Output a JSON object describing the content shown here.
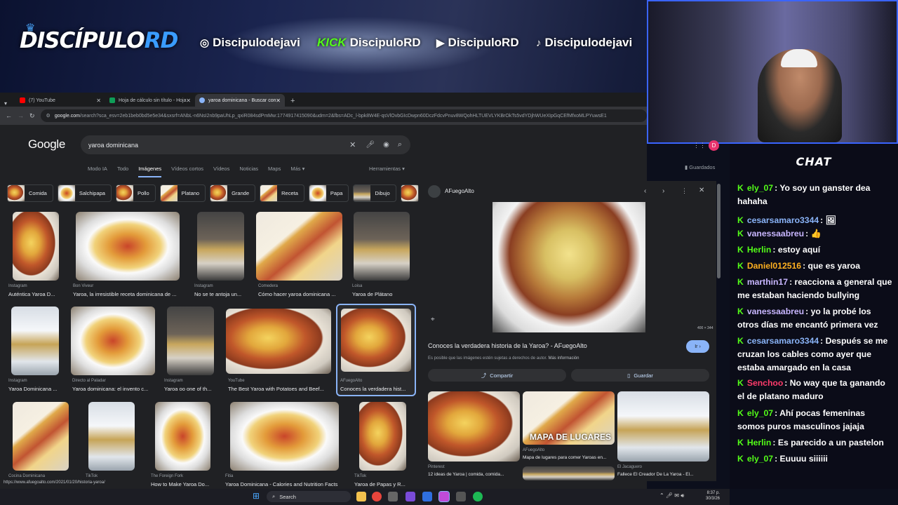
{
  "stream": {
    "logo": {
      "part1": "DISCÍPULO",
      "part2": "RD"
    },
    "socials": [
      {
        "icon": "instagram-icon",
        "handle": "Discipulodejavi"
      },
      {
        "icon": "kick-logo",
        "prefix": "KICK",
        "handle": "DiscipuloRD"
      },
      {
        "icon": "youtube-icon",
        "handle": "DiscipuloRD"
      },
      {
        "icon": "tiktok-icon",
        "handle": "Discipulodejavi"
      }
    ],
    "chat_title": "CHAT"
  },
  "browser": {
    "tabs": [
      {
        "label": "(7) YouTube",
        "color": "#ff0000"
      },
      {
        "label": "Hoja de cálculo sin título - Hoja",
        "color": "#0f9d58"
      },
      {
        "label": "yaroa dominicana - Buscar con",
        "color": "#8ab4f8"
      }
    ],
    "address": {
      "domain": "google.com",
      "path": "/search?sca_esv=2eb1beb0bd5e5e34&sxsrf=ANbL-n6NsI2nb9paUhLp_qxiR084sdPmMw:1774917415090&udm=2&fbs=ADc_l-bpk8W4E-qsVlOvbGIcDwpn60DczFdcvPnuv8WQohHLTUEVLYKBrOkTs5vdYDjhWUeXIpGqCEfMfxoMLPYuwsE1"
    },
    "status_url": "https://www.afuegoalto.com/2021/01/20/historia-yaroa/"
  },
  "google": {
    "logo": "Google",
    "query": "yaroa dominicana",
    "tabs": [
      "Modo IA",
      "Todo",
      "Imágenes",
      "Vídeos cortos",
      "Vídeos",
      "Noticias",
      "Maps",
      "Más"
    ],
    "tools": "Herramientas",
    "saved": "Guardados",
    "chips": [
      "Comida",
      "Salchipapa",
      "Pollo",
      "Platano",
      "Grande",
      "Receta",
      "Papa",
      "Dibujo"
    ],
    "results": [
      {
        "source": "Instagram",
        "title": "Auténtica Yaroa D..."
      },
      {
        "source": "Bon Viveur",
        "title": "Yaroa, la irresistible receta dominicana de ..."
      },
      {
        "source": "Instagram",
        "title": "No se te antoja un..."
      },
      {
        "source": "Comedera",
        "title": "Cómo hacer yaroa dominicana ..."
      },
      {
        "source": "Loisa",
        "title": "Yaroa de Plátano"
      },
      {
        "source": "Instagram",
        "title": "Yaroa Dominicana ..."
      },
      {
        "source": "Directo al Paladar",
        "title": "Yaroa dominicana: el invento c..."
      },
      {
        "source": "Instagram",
        "title": "Yaroa oo one of th..."
      },
      {
        "source": "YouTube",
        "title": "The Best Yaroa with Potatoes and Beef..."
      },
      {
        "source": "AFuegoAlto",
        "title": "Conoces la verdadera hist..."
      },
      {
        "source": "Cocina Dominicana",
        "title": "Yaroa Dominicana"
      },
      {
        "source": "TikTok",
        "title": ""
      },
      {
        "source": "The Foreign Fork",
        "title": "How to Make Yaroa Do..."
      },
      {
        "source": "Fitia",
        "title": "Yaroa Dominicana - Calories and Nutrition Facts"
      },
      {
        "source": "TikTok",
        "title": "Yaroa de Papas y R..."
      }
    ],
    "panel": {
      "source": "AFuegoAlto",
      "dims": "400 × 344",
      "title": "Conoces la verdadera historia de la Yaroa? - AFuegoAlto",
      "visit": "Ir",
      "note": "Es posible que las imágenes estén sujetas a derechos de autor.",
      "more": "Más información",
      "share": "Compartir",
      "save": "Guardar",
      "related": [
        {
          "source": "Pinterest",
          "title": "12 ideas de Yaroa | comida, comida..."
        },
        {
          "source": "AFuegoAlto",
          "title": "Mapa de lugares para comer Yaroas en...",
          "overlay": "MAPA DE LUGARES"
        },
        {
          "source": "El Jacaguero",
          "title": "Fallece El Creador De La Yaroa - El..."
        }
      ]
    }
  },
  "chat": [
    {
      "user": "ely_07",
      "color": "#53fc18",
      "text": "Yo soy un ganster dea hahaha"
    },
    {
      "user": "cesarsamaro3344",
      "color": "#8ab4f8",
      "text": "🖼"
    },
    {
      "user": "vanessaabreu",
      "color": "#c8b6ff",
      "text": "👍"
    },
    {
      "user": "Herlin",
      "color": "#53fc18",
      "text": "estoy aquí"
    },
    {
      "user": "Daniel012516",
      "color": "#ffb020",
      "text": "que es yaroa"
    },
    {
      "user": "marthin17",
      "color": "#c8b6ff",
      "text": "reacciona a general que me estaban haciendo bullying"
    },
    {
      "user": "vanessaabreu",
      "color": "#c8b6ff",
      "text": "yo la probé los otros días me encantó primera vez"
    },
    {
      "user": "cesarsamaro3344",
      "color": "#8ab4f8",
      "text": "Después se me cruzan los cables como ayer que estaba amargado en la casa"
    },
    {
      "user": "Senchoo",
      "color": "#ff3b6b",
      "text": "No way que ta ganando el de platano maduro"
    },
    {
      "user": "ely_07",
      "color": "#53fc18",
      "text": "Ahí pocas femeninas somos puros masculinos jajaja"
    },
    {
      "user": "Herlin",
      "color": "#53fc18",
      "text": "Es parecido a un pastelon"
    },
    {
      "user": "ely_07",
      "color": "#53fc18",
      "text": "Euuuu siiiiii"
    }
  ],
  "taskbar": {
    "search": "Search",
    "time": "8:37 p.",
    "date": "30/3/26"
  }
}
